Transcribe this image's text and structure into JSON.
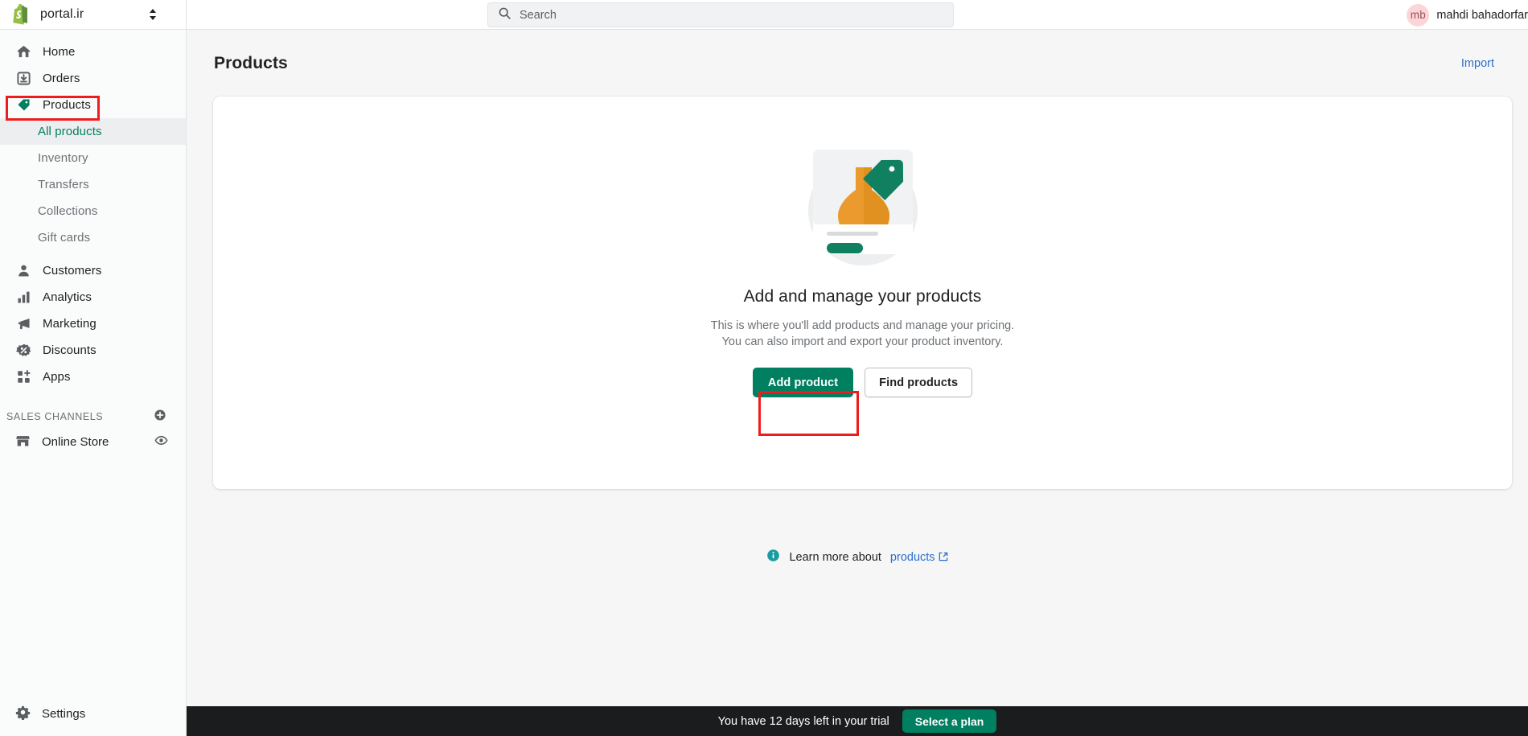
{
  "topbar": {
    "store_name": "portal.ir",
    "store_switcher_icon": "chevron-up-down-icon",
    "logo_icon": "shopify-bag-icon",
    "search": {
      "placeholder": "Search",
      "icon": "search-icon"
    },
    "user": {
      "initials": "mb",
      "name": "mahdi bahadorfar",
      "avatar_color": "#fcd5d9"
    }
  },
  "sidebar": {
    "items": [
      {
        "label": "Home",
        "icon": "home-icon"
      },
      {
        "label": "Orders",
        "icon": "orders-inbox-icon"
      },
      {
        "label": "Products",
        "icon": "product-tag-icon",
        "highlighted": true
      },
      {
        "label": "Customers",
        "icon": "customer-person-icon"
      },
      {
        "label": "Analytics",
        "icon": "analytics-bars-icon"
      },
      {
        "label": "Marketing",
        "icon": "marketing-megaphone-icon"
      },
      {
        "label": "Discounts",
        "icon": "discount-percent-icon"
      },
      {
        "label": "Apps",
        "icon": "apps-grid-plus-icon"
      }
    ],
    "product_subitems": [
      {
        "label": "All products",
        "active": true
      },
      {
        "label": "Inventory",
        "active": false
      },
      {
        "label": "Transfers",
        "active": false
      },
      {
        "label": "Collections",
        "active": false
      },
      {
        "label": "Gift cards",
        "active": false
      }
    ],
    "sales_channels": {
      "heading": "SALES CHANNELS",
      "add_icon": "plus-circle-icon",
      "channels": [
        {
          "label": "Online Store",
          "icon": "store-icon",
          "trailing_icon": "eye-icon"
        }
      ]
    },
    "settings": {
      "label": "Settings",
      "icon": "gear-icon"
    }
  },
  "main": {
    "page_title": "Products",
    "import_label": "Import",
    "empty_state": {
      "illustration": "product-card-vase-illustration",
      "title": "Add and manage your products",
      "body": "This is where you'll add products and manage your pricing. You can also import and export your product inventory.",
      "primary_button": "Add product",
      "secondary_button": "Find products",
      "primary_highlighted": true
    },
    "learn_more": {
      "icon": "info-circle-icon",
      "text": "Learn more about",
      "link": "products",
      "external_icon": "external-link-icon"
    }
  },
  "trial_banner": {
    "text": "You have 12 days left in your trial",
    "button": "Select a plan"
  },
  "colors": {
    "accent_green": "#008060",
    "active_green": "#007f5f",
    "link_blue": "#2c6ecb",
    "highlight_red": "#ee1c1c",
    "banner_dark": "#1a1c1d",
    "sidebar_bg": "#fafbfb",
    "main_bg": "#f6f6f7"
  }
}
